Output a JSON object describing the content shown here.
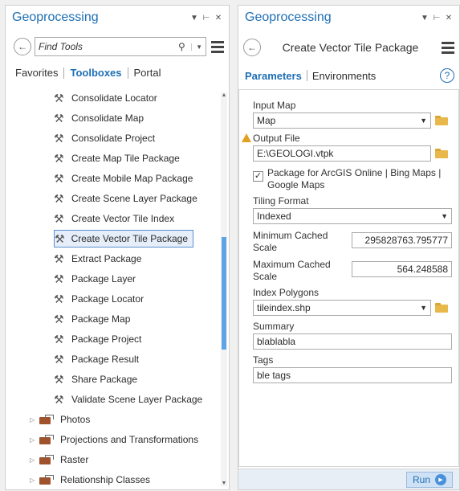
{
  "left": {
    "title": "Geoprocessing",
    "search_placeholder": "Find Tools",
    "tabs": [
      "Favorites",
      "Toolboxes",
      "Portal"
    ],
    "tools": [
      "Consolidate Locator",
      "Consolidate Map",
      "Consolidate Project",
      "Create Map Tile Package",
      "Create Mobile Map Package",
      "Create Scene Layer Package",
      "Create Vector Tile Index",
      "Create Vector Tile Package",
      "Extract Package",
      "Package Layer",
      "Package Locator",
      "Package Map",
      "Package Project",
      "Package Result",
      "Share Package",
      "Validate Scene Layer Package"
    ],
    "selected_tool_index": 7,
    "groups": [
      "Photos",
      "Projections and Transformations",
      "Raster",
      "Relationship Classes"
    ]
  },
  "right": {
    "title": "Geoprocessing",
    "tool_title": "Create Vector Tile Package",
    "tabs": [
      "Parameters",
      "Environments"
    ],
    "input_map_label": "Input Map",
    "input_map_value": "Map",
    "output_file_label": "Output File",
    "output_file_value": "E:\\GEOLOGI.vtpk",
    "checkbox_label_1": "Package for ArcGIS Online | Bing Maps |",
    "checkbox_label_2": "Google Maps",
    "checkbox_checked": true,
    "tiling_format_label": "Tiling Format",
    "tiling_format_value": "Indexed",
    "min_scale_label_1": "Minimum Cached",
    "min_scale_label_2": "Scale",
    "min_scale_value": "295828763.795777",
    "max_scale_label_1": "Maximum Cached",
    "max_scale_label_2": "Scale",
    "max_scale_value": "564.248588",
    "index_polygons_label": "Index Polygons",
    "index_polygons_value": "tileindex.shp",
    "summary_label": "Summary",
    "summary_value": "blablabla",
    "tags_label": "Tags",
    "tags_value": "ble tags",
    "run_label": "Run"
  }
}
